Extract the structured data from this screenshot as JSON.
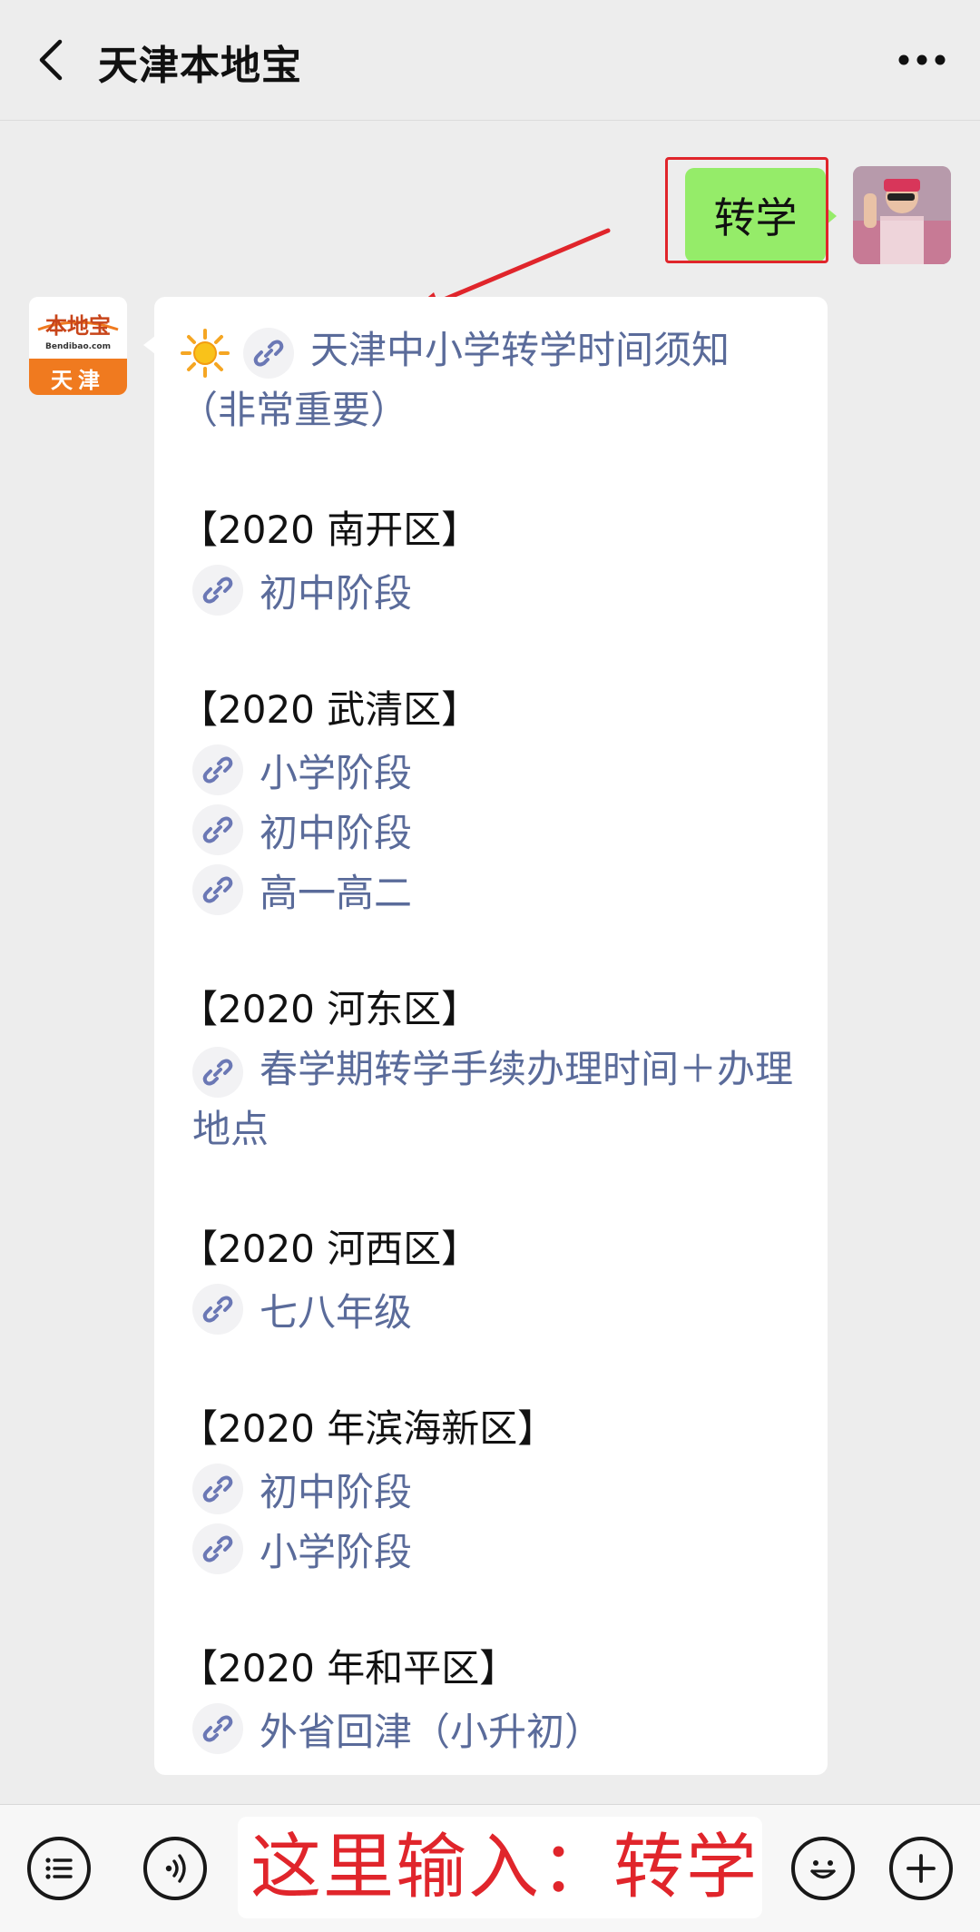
{
  "header": {
    "title": "天津本地宝",
    "back_icon": "chevron-left-icon",
    "more_icon": "more-dots-icon"
  },
  "outgoing_message": {
    "text": "转学",
    "bubble_color": "#95ec69",
    "highlight_color": "#e0252b"
  },
  "incoming_avatar": {
    "brand": "本地宝",
    "domain": "Bendibao.com",
    "city": "天津",
    "brand_color": "#f07a1f"
  },
  "incoming_message": {
    "title_link": "天津中小学转学时间须知（非常重要）",
    "sections": [
      {
        "heading": "【2020 南开区】",
        "links": [
          "初中阶段"
        ]
      },
      {
        "heading": "【2020 武清区】",
        "links": [
          "小学阶段",
          "初中阶段",
          "高一高二"
        ]
      },
      {
        "heading": "【2020 河东区】",
        "links": [
          "春学期转学手续办理时间＋办理地点"
        ]
      },
      {
        "heading": "【2020 河西区】",
        "links": [
          "七八年级"
        ]
      },
      {
        "heading": "【2020 年滨海新区】",
        "links": [
          "初中阶段",
          "小学阶段"
        ]
      },
      {
        "heading": "【2020 年和平区】",
        "links": [
          "外省回津（小升初）"
        ]
      }
    ],
    "link_color": "#5a6b9a"
  },
  "input_bar": {
    "text": "这里输入：转学",
    "text_color": "#e0252b",
    "menu_icon": "list-menu-icon",
    "voice_icon": "voice-icon",
    "emoji_icon": "emoji-icon",
    "add_icon": "plus-icon"
  }
}
